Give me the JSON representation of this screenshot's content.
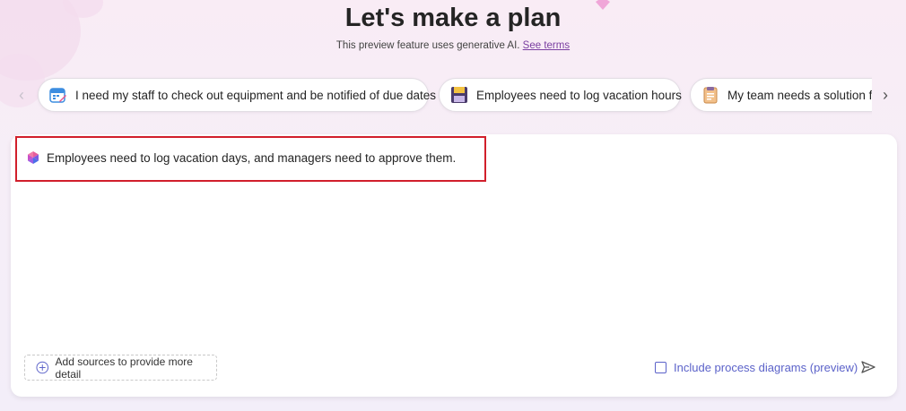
{
  "header": {
    "title": "Let's make a plan",
    "subtitle": "This preview feature uses generative AI.",
    "terms_link": "See terms"
  },
  "suggestions": [
    {
      "label": "I need my staff to check out equipment and be notified of due dates",
      "icon": "calendar-icon"
    },
    {
      "label": "Employees need to log vacation hours",
      "icon": "floppy-disk-icon"
    },
    {
      "label": "My team needs a solution for",
      "icon": "clipboard-icon"
    }
  ],
  "prompt": {
    "text": "Employees need to log vacation days, and managers need to approve them."
  },
  "footer": {
    "add_sources_label": "Add sources to provide more detail",
    "include_diagrams_label": "Include process diagrams (preview)",
    "include_diagrams_checked": false
  },
  "colors": {
    "accent": "#5b62c9",
    "highlight": "#d11f2b",
    "link": "#7a3ea1"
  }
}
